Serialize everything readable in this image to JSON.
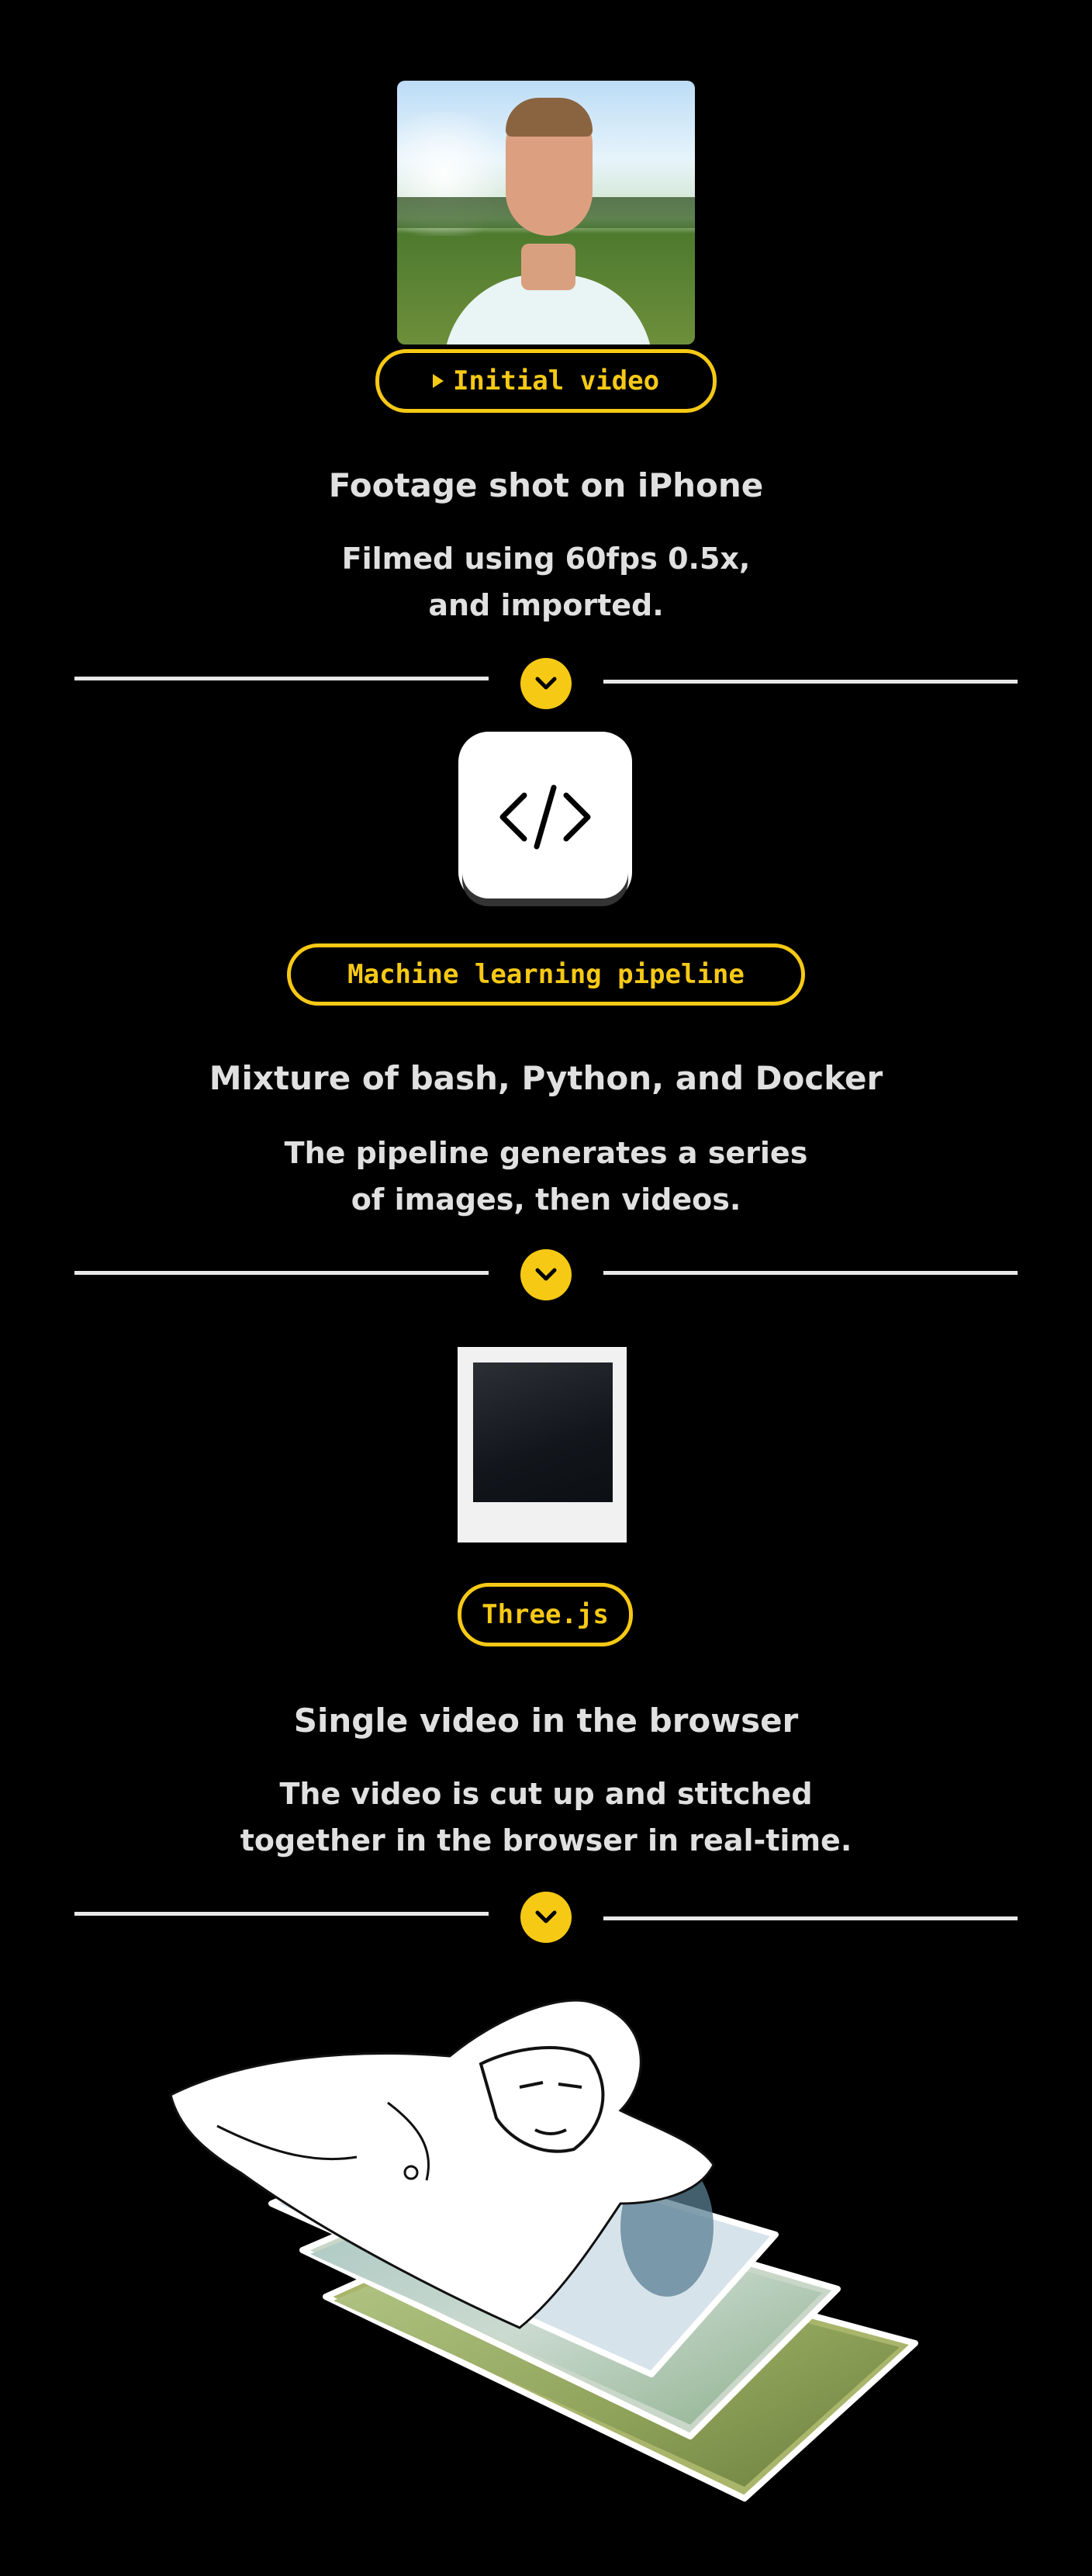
{
  "step1": {
    "badge": "Initial video",
    "title": "Footage shot on iPhone",
    "desc_line1": "Filmed using 60fps 0.5x,",
    "desc_line2": "and imported."
  },
  "step2": {
    "badge": "Machine learning pipeline",
    "title": "Mixture of bash, Python, and Docker",
    "desc_line1": "The pipeline generates a series",
    "desc_line2": "of images, then videos."
  },
  "step3": {
    "badge": "Three.js",
    "title": "Single video in the browser",
    "desc_line1": "The video is cut up and stitched",
    "desc_line2": "together in the browser in real-time."
  },
  "colors": {
    "accent": "#f6c915",
    "background": "#000000",
    "text": "#e0e0e0"
  },
  "icons": [
    "play-icon",
    "chevron-down-icon",
    "code-icon"
  ]
}
